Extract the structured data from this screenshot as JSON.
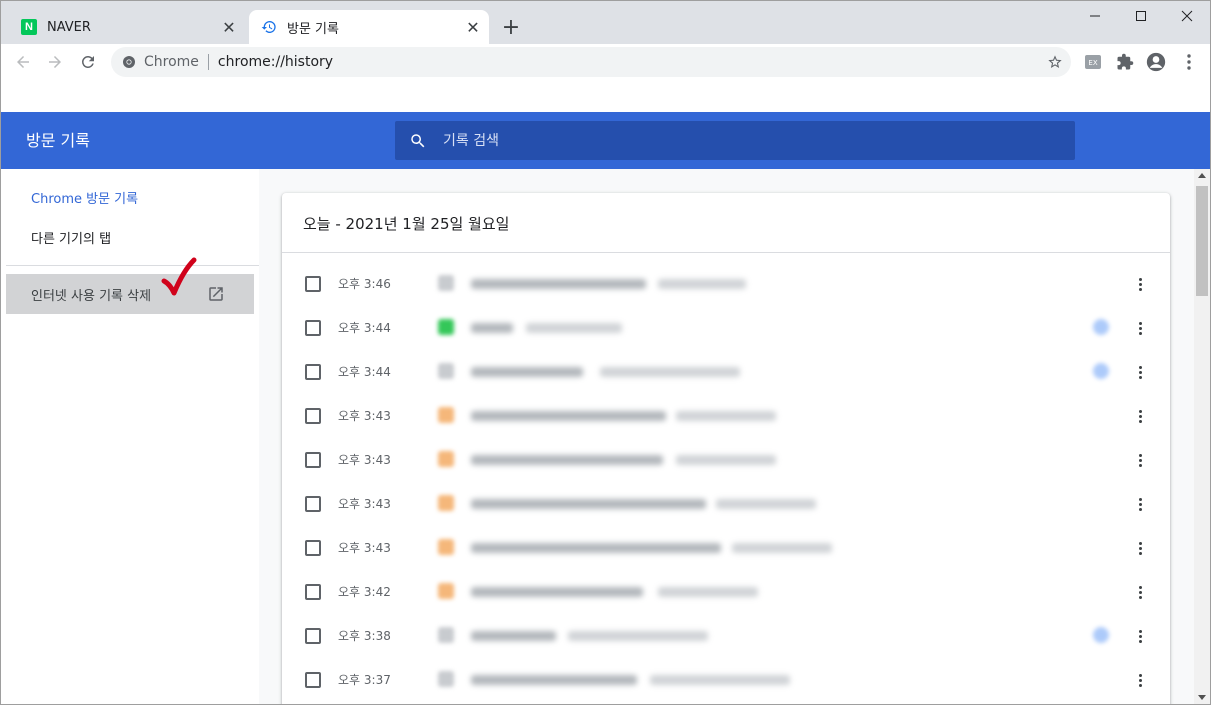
{
  "tabs": [
    {
      "title": "NAVER",
      "favicon": "naver-logo-icon",
      "active": false
    },
    {
      "title": "방문 기록",
      "favicon": "history-icon",
      "active": true
    }
  ],
  "naver_logo_letter": "N",
  "window_controls": {
    "minimize": "minimize-icon",
    "maximize": "maximize-icon",
    "close": "close-icon"
  },
  "toolbar": {
    "site_label": "Chrome",
    "url": "chrome://history"
  },
  "history": {
    "header_title": "방문 기록",
    "search_placeholder": "기록 검색",
    "sidebar": {
      "chrome_history": "Chrome 방문 기록",
      "other_devices": "다른 기기의 탭",
      "clear_browsing": "인터넷 사용 기록 삭제"
    },
    "day_title": "오늘 - 2021년 1월 25일 월요일",
    "entries": [
      {
        "time": "오후 3:46"
      },
      {
        "time": "오후 3:44"
      },
      {
        "time": "오후 3:44"
      },
      {
        "time": "오후 3:43"
      },
      {
        "time": "오후 3:43"
      },
      {
        "time": "오후 3:43"
      },
      {
        "time": "오후 3:43"
      },
      {
        "time": "오후 3:42"
      },
      {
        "time": "오후 3:38"
      },
      {
        "time": "오후 3:37"
      }
    ]
  },
  "colors": {
    "header_blue": "#3367d6",
    "search_bg": "#254fad",
    "annotation_red": "#d0021b",
    "naver_green": "#03c75a"
  }
}
